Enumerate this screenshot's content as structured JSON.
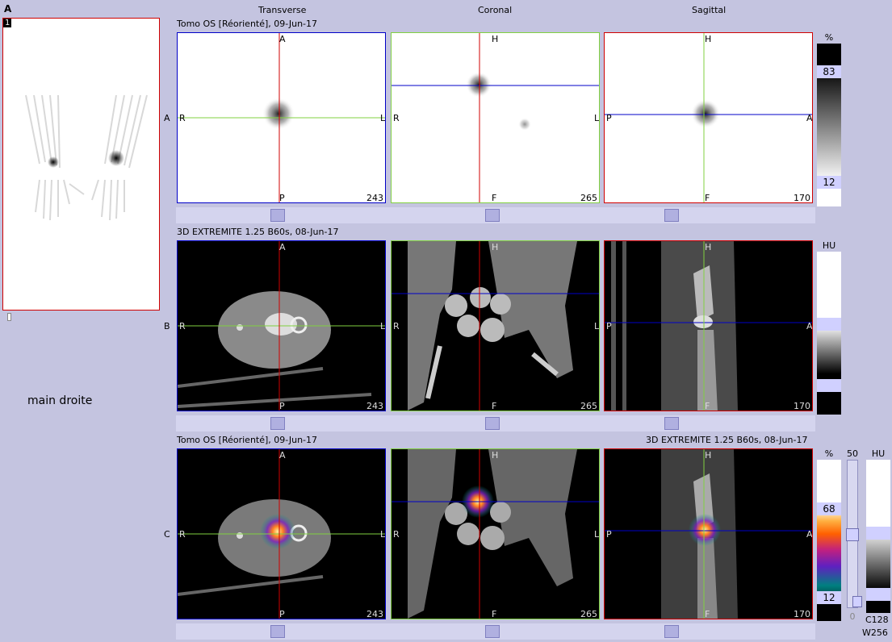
{
  "top_label": "A",
  "top_right_text": "",
  "mip": {
    "badge": "1",
    "caption": "main droite"
  },
  "columns": {
    "transverse": "Transverse",
    "coronal": "Coronal",
    "sagittal": "Sagittal"
  },
  "rows": [
    {
      "label": "A",
      "series_left": "Tomo OS [Réorienté], 09-Jun-17",
      "series_right": "",
      "scale_unit": "%",
      "scale_max": "83",
      "scale_min": "12"
    },
    {
      "label": "B",
      "series_left": "3D EXTREMITE  1.25  B60s, 08-Jun-17",
      "series_right": "",
      "scale_unit": "HU",
      "scale_max": "",
      "scale_min": ""
    },
    {
      "label": "C",
      "series_left": "Tomo OS [Réorienté], 09-Jun-17",
      "series_right": "3D EXTREMITE  1.25  B60s, 08-Jun-17",
      "scale_unit": "%",
      "scale_max": "68",
      "scale_min": "12",
      "blend_max": "50",
      "blend_min": "0",
      "ct_unit": "HU",
      "ct_center": "C128",
      "ct_width": "W256"
    }
  ],
  "orient": {
    "transverse": {
      "top": "A",
      "bottom": "P",
      "left": "R",
      "right": "L",
      "slice": "243"
    },
    "coronal": {
      "top": "H",
      "bottom": "F",
      "left": "R",
      "right": "L",
      "slice": "265"
    },
    "sagittal": {
      "top": "H",
      "bottom": "F",
      "left": "P",
      "right": "A",
      "slice": "170"
    }
  },
  "colors": {
    "background": "#c4c4e0",
    "transverse_border": "#0000c8",
    "coronal_border": "#80d040",
    "sagittal_border": "#d00000"
  }
}
